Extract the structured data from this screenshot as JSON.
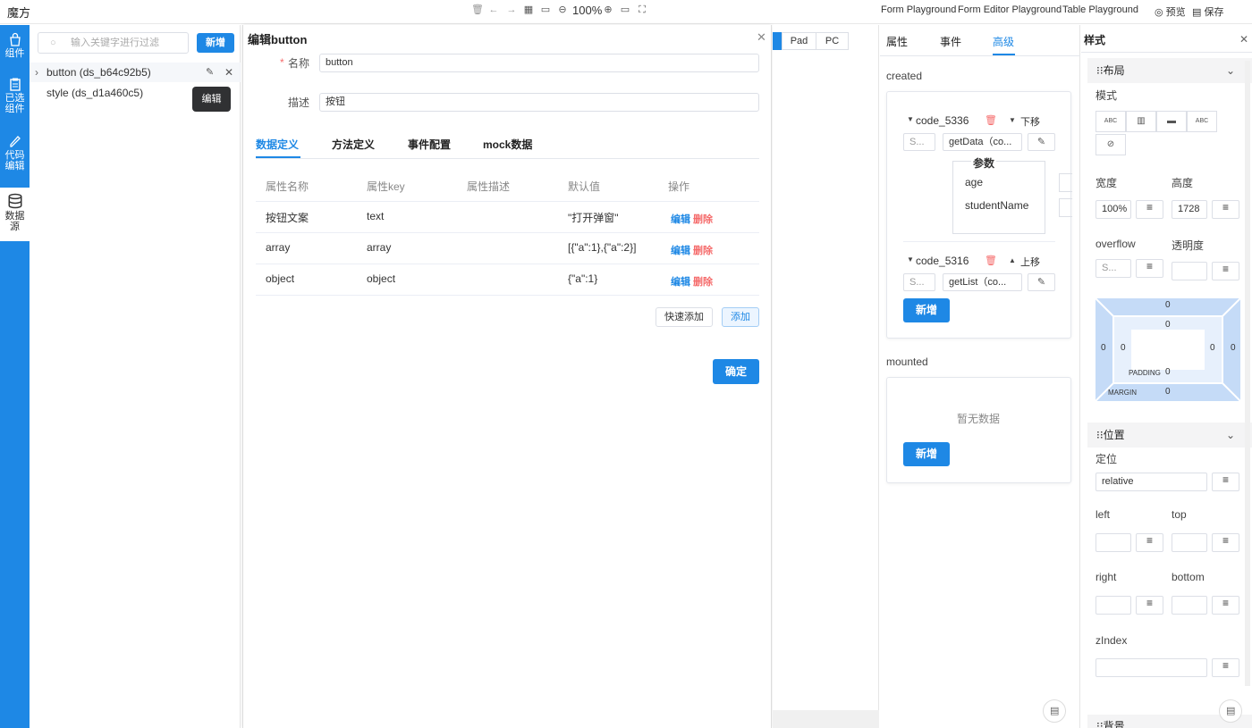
{
  "app": {
    "title": "魔方"
  },
  "toolbar": {
    "zoom": "100%"
  },
  "top_links": {
    "form_playground": "Form Playground",
    "form_editor_playground": "Form Editor Playground",
    "table_playground": "Table Playground",
    "preview": "预览",
    "save": "保存"
  },
  "rail": {
    "components": "组件",
    "selected_1": "已选",
    "selected_2": "组件",
    "code_1": "代码",
    "code_2": "编辑",
    "datasource_1": "数据",
    "datasource_2": "源"
  },
  "tree": {
    "filter_placeholder": "输入关键字进行过滤",
    "add_label": "新增",
    "items": [
      {
        "label": "button (ds_b64c92b5)"
      },
      {
        "label": "style (ds_d1a460c5)"
      }
    ],
    "tooltip": "编辑"
  },
  "dialog": {
    "title": "编辑button",
    "name_label": "名称",
    "name_value": "button",
    "desc_label": "描述",
    "desc_value": "按钮",
    "tabs": [
      "数据定义",
      "方法定义",
      "事件配置",
      "mock数据"
    ],
    "columns": [
      "属性名称",
      "属性key",
      "属性描述",
      "默认值",
      "操作"
    ],
    "rows": [
      {
        "name": "按钮文案",
        "key": "text",
        "desc": "",
        "default": "\"打开弹窗\"",
        "edit": "编辑",
        "delete": "删除"
      },
      {
        "name": "array",
        "key": "array",
        "desc": "",
        "default": "[{\"a\":1},{\"a\":2}]",
        "edit": "编辑",
        "delete": "删除"
      },
      {
        "name": "object",
        "key": "object",
        "desc": "",
        "default": "{\"a\":1}",
        "edit": "编辑",
        "delete": "删除"
      }
    ],
    "quick_add": "快速添加",
    "add": "添加",
    "confirm": "确定"
  },
  "canvas": {
    "pad": "Pad",
    "pc": "PC"
  },
  "props": {
    "tabs": [
      "属性",
      "事件",
      "高级"
    ],
    "created_label": "created",
    "mounted_label": "mounted",
    "code1": {
      "name": "code_5336",
      "move": "下移",
      "select": "S...",
      "method": "getData（co..."
    },
    "params_title": "参数",
    "params": [
      "age",
      "studentName"
    ],
    "code2": {
      "name": "code_5316",
      "move": "上移",
      "select": "S...",
      "method": "getList（co..."
    },
    "add_label": "新增",
    "empty": "暂无数据",
    "add_label_2": "新增"
  },
  "styles": {
    "title": "样式",
    "layout_head": "布局",
    "mode_label": "模式",
    "modes": [
      "ABC",
      "",
      "",
      "ABC"
    ],
    "width_label": "宽度",
    "height_label": "高度",
    "width_value": "100%",
    "height_value": "1728",
    "overflow_label": "overflow",
    "opacity_label": "透明度",
    "overflow_value": "S...",
    "box": {
      "margin_top": "0",
      "padding_top": "0",
      "margin_left": "0",
      "padding_left": "0",
      "padding_right": "0",
      "margin_right": "0",
      "padding_label": "PADDING",
      "padding_bottom": "0",
      "margin_label": "MARGIN",
      "margin_bottom": "0"
    },
    "position_head": "位置",
    "position_label": "定位",
    "position_value": "relative",
    "left_label": "left",
    "top_label": "top",
    "right_label": "right",
    "bottom_label": "bottom",
    "zindex_label": "zIndex",
    "bg_head": "背景"
  }
}
